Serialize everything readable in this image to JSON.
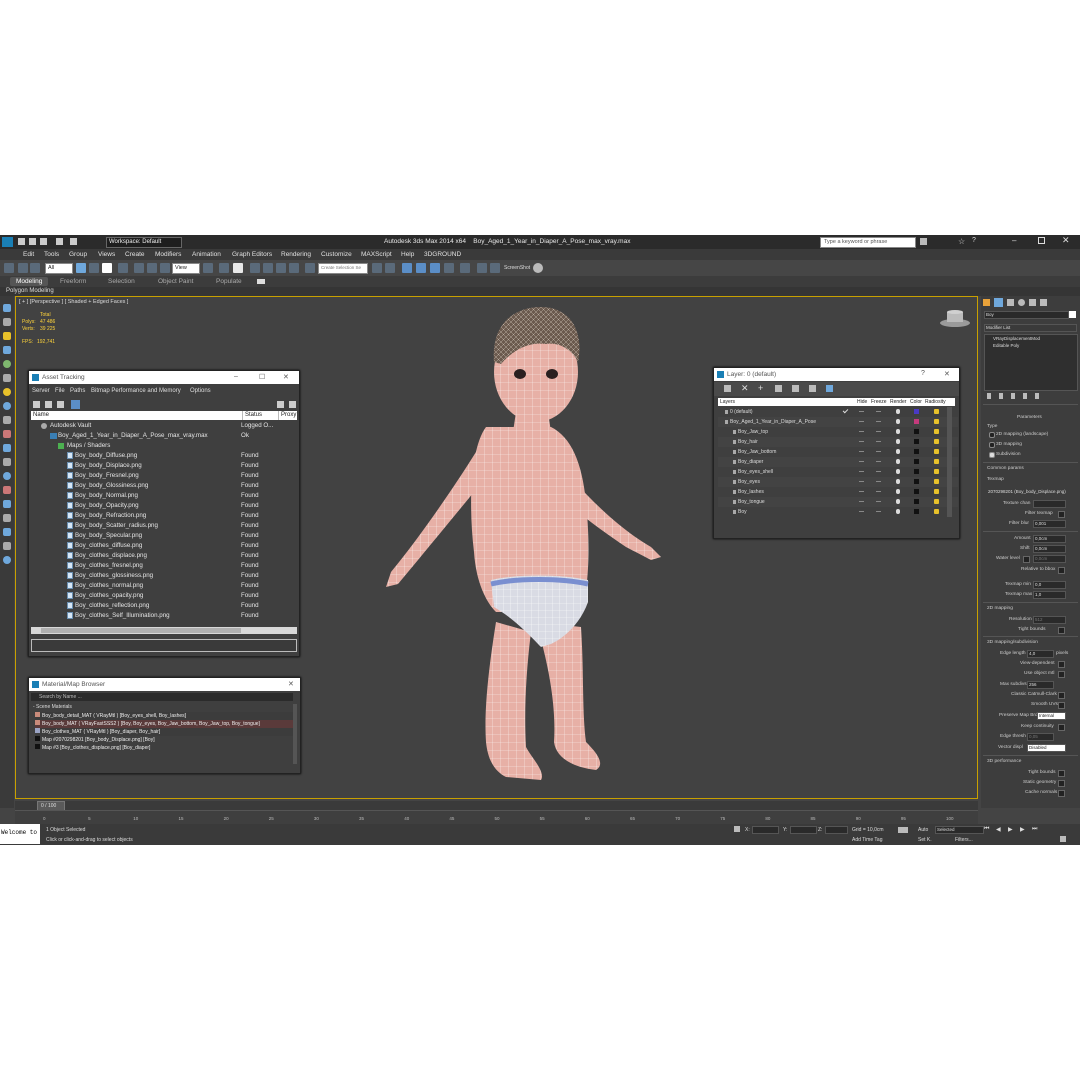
{
  "app": {
    "title": "Autodesk 3ds Max  2014 x64",
    "file": "Boy_Aged_1_Year_in_Diaper_A_Pose_max_vray.max",
    "workspace": "Workspace: Default",
    "search_placeholder": "Type a keyword or phrase"
  },
  "menu": [
    "Edit",
    "Tools",
    "Group",
    "Views",
    "Create",
    "Modifiers",
    "Animation",
    "Graph Editors",
    "Rendering",
    "Customize",
    "MAXScript",
    "Help",
    "3DGROUND"
  ],
  "toolbar": {
    "filter": "All",
    "view": "View",
    "selection_set": "Create Selection Se",
    "screenshot": "ScreenShot"
  },
  "ribbon": {
    "tabs": [
      "Modeling",
      "Freeform",
      "Selection",
      "Object Paint",
      "Populate"
    ],
    "sub": "Polygon Modeling"
  },
  "viewport": {
    "label": "[ + ] [Perspective ] [ Shaded + Edged Faces ]",
    "stats": {
      "total": "Total",
      "polys_label": "Polys:",
      "polys": "47 486",
      "verts_label": "Verts:",
      "verts": "39 225",
      "fps_label": "FPS:",
      "fps": "192,741"
    }
  },
  "asset_tracking": {
    "title": "Asset Tracking",
    "menu": [
      "Server",
      "File",
      "Paths",
      "Bitmap Performance and Memory",
      "Options"
    ],
    "columns": [
      "Name",
      "Status",
      "Proxy R"
    ],
    "vault": {
      "name": "Autodesk Vault",
      "status": "Logged O..."
    },
    "file": {
      "name": "Boy_Aged_1_Year_in_Diaper_A_Pose_max_vray.max",
      "status": "Ok"
    },
    "group": "Maps / Shaders",
    "files": [
      {
        "name": "Boy_body_Diffuse.png",
        "status": "Found"
      },
      {
        "name": "Boy_body_Displace.png",
        "status": "Found"
      },
      {
        "name": "Boy_body_Fresnel.png",
        "status": "Found"
      },
      {
        "name": "Boy_body_Glossiness.png",
        "status": "Found"
      },
      {
        "name": "Boy_body_Normal.png",
        "status": "Found"
      },
      {
        "name": "Boy_body_Opacity.png",
        "status": "Found"
      },
      {
        "name": "Boy_body_Refraction.png",
        "status": "Found"
      },
      {
        "name": "Boy_body_Scatter_radius.png",
        "status": "Found"
      },
      {
        "name": "Boy_body_Specular.png",
        "status": "Found"
      },
      {
        "name": "Boy_clothes_diffuse.png",
        "status": "Found"
      },
      {
        "name": "Boy_clothes_displace.png",
        "status": "Found"
      },
      {
        "name": "Boy_clothes_fresnel.png",
        "status": "Found"
      },
      {
        "name": "Boy_clothes_glossiness.png",
        "status": "Found"
      },
      {
        "name": "Boy_clothes_normal.png",
        "status": "Found"
      },
      {
        "name": "Boy_clothes_opacity.png",
        "status": "Found"
      },
      {
        "name": "Boy_clothes_reflection.png",
        "status": "Found"
      },
      {
        "name": "Boy_clothes_Self_Illumination.png",
        "status": "Found"
      }
    ]
  },
  "material_browser": {
    "title": "Material/Map Browser",
    "search": "Search by Name ...",
    "section": "- Scene Materials",
    "items": [
      "Boy_body_detail_MAT ( VRayMtl ) [Boy_eyes_shell, Boy_lashes]",
      "Boy_body_MAT ( VRayFastSSS2 ) [Boy, Boy_eyes, Boy_Jaw_bottom, Boy_Jaw_top, Boy_tongue]",
      "Boy_clothes_MAT ( VRayMtl ) [Boy_diaper, Boy_hair]",
      "Map #2070298201 [Boy_body_Displace.png] [Boy]",
      "Map #3 [Boy_clothes_displace.png] [Boy_diaper]"
    ]
  },
  "layer_manager": {
    "title": "Layer: 0 (default)",
    "columns": [
      "Layers",
      "Hide",
      "Freeze",
      "Render",
      "Color",
      "Radiosity"
    ],
    "layers": [
      "0 (default)",
      "Boy_Aged_1_Year_in_Diaper_A_Pose",
      "Boy_Jaw_top",
      "Boy_hair",
      "Boy_Jaw_bottom",
      "Boy_diaper",
      "Boy_eyes_shell",
      "Boy_eyes",
      "Boy_lashes",
      "Boy_tongue",
      "Boy"
    ]
  },
  "command_panel": {
    "object_name": "Boy",
    "modifier_list": "Modifier List",
    "stack": [
      "VRayDisplacementMod",
      "Editable Poly"
    ],
    "parameters": "Parameters",
    "type_label": "Type",
    "types": [
      "2D mapping (landscape)",
      "3D mapping",
      "Subdivision"
    ],
    "common": "Common params",
    "texmap_label": "Texmap",
    "texmap": "2070298201 (Boy_body_Displace.png)",
    "texture_chan": "Texture chan",
    "filter_texmap": "Filter texmap",
    "filter_blur": "Filter blur",
    "filter_blur_val": "0,001",
    "amount": "Amount",
    "amount_val": "0,0cm",
    "shift": "Shift",
    "shift_val": "0,0cm",
    "water": "Water level",
    "water_val": "0,0cm",
    "relative": "Relative to bbox",
    "texmap_min": "Texmap min",
    "texmap_min_val": "0,0",
    "texmap_max": "Texmap max",
    "texmap_max_val": "1,0",
    "map2d": "2D mapping",
    "resolution": "Resolution",
    "resolution_val": "512",
    "tight": "Tight bounds",
    "map3d": "3D mapping/subdivision",
    "edge_length": "Edge length",
    "edge_length_val": "4,0",
    "pixels": "pixels",
    "view_dep": "View-dependent",
    "use_obj": "Use object mtl",
    "max_subdivs": "Max subdivs",
    "max_subdivs_val": "256",
    "classic": "Classic Catmull-Clark",
    "smooth_uvs": "Smooth UVs",
    "preserve": "Preserve Map Brdr",
    "preserve_val": "Internal",
    "keep_cont": "Keep continuity",
    "edge_thresh": "Edge thresh",
    "edge_thresh_val": "0,05",
    "vector_disp": "Vector displ",
    "vector_disp_val": "Disabled",
    "perf": "3D performance",
    "tight2": "Tight bounds",
    "static_geo": "Static geometry",
    "cache": "Cache normals"
  },
  "timeline": {
    "frame": "0 / 100",
    "ticks": [
      "0",
      "5",
      "10",
      "15",
      "20",
      "25",
      "30",
      "35",
      "40",
      "45",
      "50",
      "55",
      "60",
      "65",
      "70",
      "75",
      "80",
      "85",
      "90",
      "95",
      "100"
    ]
  },
  "status": {
    "maxscript": "Welcome to",
    "selected": "1 Object Selected",
    "prompt": "Click or click-and-drag to select objects",
    "x_label": "X:",
    "y_label": "Y:",
    "z_label": "Z:",
    "grid": "Grid = 10,0cm",
    "add_time_tag": "Add Time Tag",
    "auto": "Auto",
    "auto_val": "Selected",
    "setk": "Set K.",
    "filters": "Filters..."
  },
  "colors": {
    "viewport_bg": "#424242",
    "ui_bg": "#444444",
    "accent": "#1a7fb5",
    "active_border": "#c8a000"
  }
}
